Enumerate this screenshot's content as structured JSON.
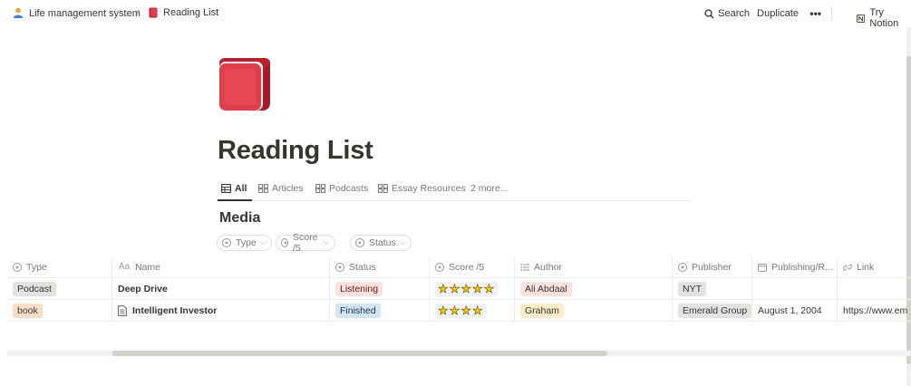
{
  "breadcrumb": {
    "parent": "Life management system",
    "separator": "/",
    "current": "Reading List"
  },
  "topbar": {
    "search": "Search",
    "duplicate": "Duplicate",
    "more": "•••",
    "try_notion": "Try Notion"
  },
  "page": {
    "icon": "red-book-icon",
    "title": "Reading List"
  },
  "views": [
    {
      "label": "All",
      "icon": "table-icon",
      "active": true
    },
    {
      "label": "Articles",
      "icon": "gallery-icon"
    },
    {
      "label": "Podcasts",
      "icon": "gallery-icon"
    },
    {
      "label": "Essay Resources",
      "icon": "gallery-icon"
    },
    {
      "label": "2 more..."
    }
  ],
  "database": {
    "title": "Media",
    "filters": [
      {
        "label": "Type"
      },
      {
        "label": "Score /5"
      },
      {
        "label": "Status"
      }
    ],
    "columns": [
      {
        "label": "Type",
        "icon": "select-icon"
      },
      {
        "label": "Name",
        "icon": "text-aa-icon"
      },
      {
        "label": "Status",
        "icon": "select-icon"
      },
      {
        "label": "Score /5",
        "icon": "select-icon"
      },
      {
        "label": "Author",
        "icon": "list-icon"
      },
      {
        "label": "Publisher",
        "icon": "select-icon"
      },
      {
        "label": "Publishing/R...",
        "icon": "calendar-icon"
      },
      {
        "label": "Link",
        "icon": "link-icon"
      }
    ],
    "rows": [
      {
        "type": "Podcast",
        "name": "Deep Drive",
        "status": "Listening",
        "score": "⭐⭐⭐⭐⭐",
        "score_value": 5,
        "author": "Ali Abdaal",
        "publisher": "NYT",
        "date": "",
        "link": ""
      },
      {
        "type": "book",
        "name": "Intelligent Investor",
        "status": "Finished",
        "score": "⭐⭐⭐⭐",
        "score_value": 4,
        "author": "Graham",
        "publisher": "Emerald Group",
        "date": "August 1, 2004",
        "link": "https://www.em"
      }
    ]
  },
  "colors": {
    "text": "#37352f",
    "muted": "#787774",
    "tag_gray": "#e3e2e0",
    "tag_orange": "#fadec9",
    "tag_red": "#ffe2dd",
    "tag_blue": "#d3e5ef",
    "tag_yellow": "#fdecc8",
    "book_red": "#e03e3e"
  }
}
